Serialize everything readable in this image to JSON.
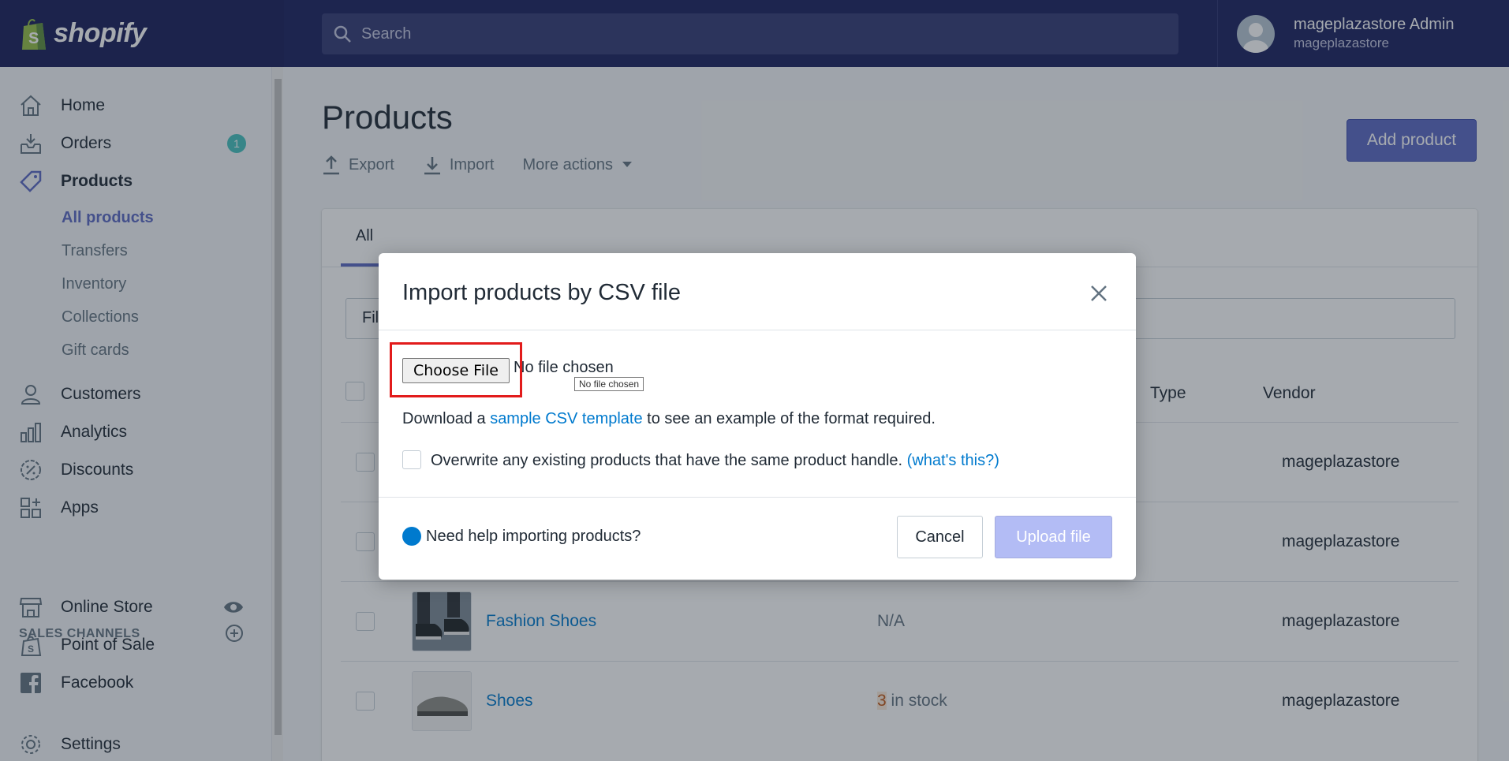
{
  "brand": {
    "name": "shopify"
  },
  "search": {
    "placeholder": "Search"
  },
  "account": {
    "name": "mageplazastore Admin",
    "store": "mageplazastore"
  },
  "sidebar": {
    "items": [
      {
        "label": "Home",
        "icon": "home-icon"
      },
      {
        "label": "Orders",
        "icon": "orders-icon",
        "badge": "1"
      },
      {
        "label": "Products",
        "icon": "tag-icon"
      },
      {
        "label": "Customers",
        "icon": "person-icon"
      },
      {
        "label": "Analytics",
        "icon": "bar-chart-icon"
      },
      {
        "label": "Discounts",
        "icon": "discount-icon"
      },
      {
        "label": "Apps",
        "icon": "apps-icon"
      }
    ],
    "product_subitems": [
      "All products",
      "Transfers",
      "Inventory",
      "Collections",
      "Gift cards"
    ],
    "sales_channels_heading": "SALES CHANNELS",
    "channels": [
      {
        "label": "Online Store",
        "icon": "store-icon"
      },
      {
        "label": "Point of Sale",
        "icon": "pos-icon"
      },
      {
        "label": "Facebook",
        "icon": "facebook-icon"
      }
    ],
    "settings_label": "Settings"
  },
  "page": {
    "title": "Products",
    "export_label": "Export",
    "import_label": "Import",
    "more_actions_label": "More actions",
    "add_product_label": "Add product",
    "tab_all": "All",
    "filter_placeholder": "Fil",
    "columns": {
      "type": "Type",
      "vendor": "Vendor"
    }
  },
  "products": [
    {
      "name": "",
      "inventory": "",
      "inventory_count": "",
      "vendor": "mageplazastore"
    },
    {
      "name": "",
      "inventory": "",
      "inventory_count": "",
      "vendor": "mageplazastore"
    },
    {
      "name": "Fashion Shoes",
      "inventory": "N/A",
      "inventory_count": "",
      "vendor": "mageplazastore"
    },
    {
      "name": "Shoes",
      "inventory": " in stock",
      "inventory_count": "3",
      "vendor": "mageplazastore"
    }
  ],
  "modal": {
    "title": "Import products by CSV file",
    "choose_file_label": "Choose File",
    "file_status": "No file chosen",
    "tooltip": "No file chosen",
    "download_prefix": "Download a ",
    "download_link": "sample CSV template",
    "download_suffix": " to see an example of the format required.",
    "overwrite_label": "Overwrite any existing products that have the same product handle.",
    "overwrite_help_link": "(what's this?)",
    "help_text": "Need help importing products?",
    "cancel_label": "Cancel",
    "upload_label": "Upload file"
  },
  "colors": {
    "topbar": "#1c2260",
    "accent": "#5c6ac4",
    "link": "#007ace",
    "highlight": "#e21b1b"
  }
}
